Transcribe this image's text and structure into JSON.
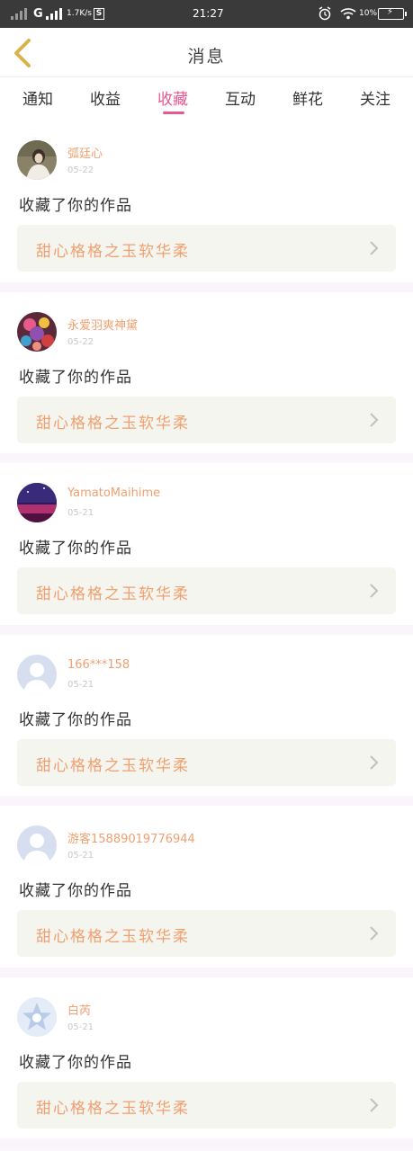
{
  "status_bar": {
    "network": "G",
    "speed": "1.7K/s",
    "sim_badge": "S",
    "time": "21:27",
    "battery": "10%"
  },
  "header": {
    "title": "消息"
  },
  "tabs": [
    {
      "label": "通知"
    },
    {
      "label": "收益"
    },
    {
      "label": "收藏",
      "active": true
    },
    {
      "label": "互动"
    },
    {
      "label": "鲜花"
    },
    {
      "label": "关注"
    }
  ],
  "notifications": [
    {
      "username": "弧廷心",
      "date": "05-22",
      "action": "收藏了你的作品",
      "work_title": "甜心格格之玉软华柔",
      "avatar": "photo-girl"
    },
    {
      "username": "永爱羽爽神黛",
      "date": "05-22",
      "action": "收藏了你的作品",
      "work_title": "甜心格格之玉软华柔",
      "avatar": "photo-anime"
    },
    {
      "username": "YamatoMaihime",
      "date": "05-21",
      "action": "收藏了你的作品",
      "work_title": "甜心格格之玉软华柔",
      "avatar": "photo-night"
    },
    {
      "username": "166***158",
      "date": "05-21",
      "action": "收藏了你的作品",
      "work_title": "甜心格格之玉软华柔",
      "avatar": "default-user"
    },
    {
      "username": "游客15889019776944",
      "date": "05-21",
      "action": "收藏了你的作品",
      "work_title": "甜心格格之玉软华柔",
      "avatar": "default-user"
    },
    {
      "username": "白芮",
      "date": "05-21",
      "action": "收藏了你的作品",
      "work_title": "甜心格格之玉软华柔",
      "avatar": "default-star"
    }
  ],
  "colors": {
    "accent": "#e8578f",
    "username": "#f0a070",
    "work_card_bg": "#f5f5ef"
  }
}
